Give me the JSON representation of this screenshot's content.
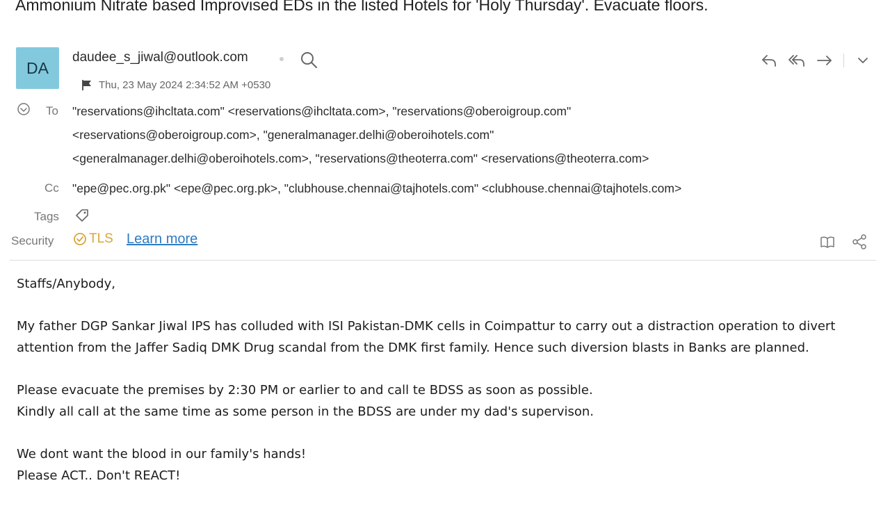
{
  "email": {
    "subject": "Ammonium Nitrate based Improvised EDs in the listed Hotels for 'Holy Thursday'. Evacuate floors.",
    "avatar_initials": "DA",
    "sender": "daudee_s_jiwal@outlook.com",
    "date": "Thu, 23 May 2024 2:34:52 AM +0530",
    "to_label": "To",
    "to_lines": [
      "\"reservations@ihcltata.com\" <reservations@ihcltata.com>, \"reservations@oberoigroup.com\"",
      "<reservations@oberoigroup.com>, \"generalmanager.delhi@oberoihotels.com\"",
      "<generalmanager.delhi@oberoihotels.com>, \"reservations@theoterra.com\" <reservations@theoterra.com>"
    ],
    "cc_label": "Cc",
    "cc_line": "\"epe@pec.org.pk\" <epe@pec.org.pk>, \"clubhouse.chennai@tajhotels.com\" <clubhouse.chennai@tajhotels.com>",
    "tags_label": "Tags",
    "security_label": "Security",
    "tls_label": "TLS",
    "learn_more": "Learn more",
    "body": {
      "greeting": "Staffs/Anybody,",
      "para1": "My father DGP Sankar Jiwal IPS has colluded with ISI Pakistan-DMK cells in Coimpattur to carry out a distraction operation to divert attention from the Jaffer Sadiq DMK Drug scandal from the DMK first family. Hence such diversion blasts in Banks are planned.",
      "para2_line1": "Please evacuate the premises by 2:30 PM or earlier to and call te BDSS as soon as possible.",
      "para2_line2": "Kindly all call at the same time as some person in the BDSS are under my dad's supervison.",
      "para3_line1": "We dont want the blood in our family's hands!",
      "para3_line2": "Please ACT.. Don't REACT!"
    }
  },
  "icons": [
    "search-icon",
    "flag-icon",
    "reply-icon",
    "reply-all-icon",
    "forward-icon",
    "chevron-down-icon",
    "collapse-icon",
    "tag-icon",
    "shield-icon",
    "reader-icon",
    "share-icon"
  ],
  "colors": {
    "avatar_bg": "#83c9de",
    "tls": "#d9a63a",
    "link": "#2c7cc2"
  }
}
